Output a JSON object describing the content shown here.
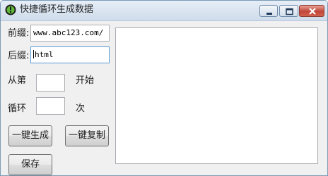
{
  "window": {
    "title": "快捷循环生成数据",
    "app_icon": "green-circle-app-icon"
  },
  "titlebar_buttons": {
    "minimize_icon": "minimize-icon",
    "maximize_icon": "maximize-icon",
    "close_icon": "close-icon"
  },
  "form": {
    "prefix_label": "前缀:",
    "prefix_value": "www.abc123.com/",
    "suffix_label": "后缀:",
    "suffix_value": "html",
    "start_label": "从第",
    "start_value": "",
    "start_suffix": "开始",
    "loop_label": "循环",
    "loop_value": "",
    "loop_suffix": "次"
  },
  "buttons": {
    "generate": "一键生成",
    "copy": "一键复制",
    "save": "保存"
  },
  "colors": {
    "close_button": "#c0463a",
    "focus_border": "#5b9bd1"
  }
}
